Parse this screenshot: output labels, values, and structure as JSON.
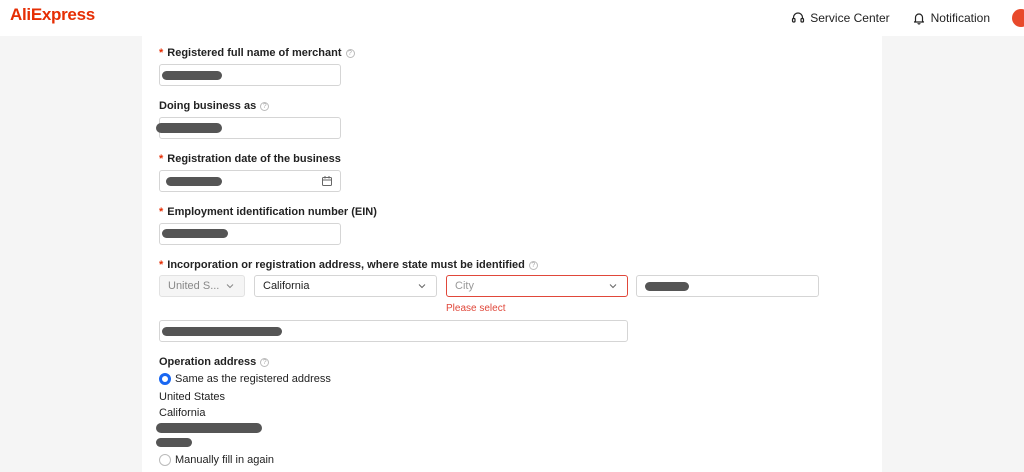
{
  "header": {
    "logo": "AliExpress",
    "service_center": "Service Center",
    "notification": "Notification"
  },
  "form": {
    "merchant_name_label": "Registered full name of merchant",
    "dba_label": "Doing business as",
    "reg_date_label": "Registration date of the business",
    "ein_label": "Employment identification number (EIN)",
    "address_label": "Incorporation or registration address, where state must be identified",
    "country_value": "United S...",
    "state_value": "California",
    "city_placeholder": "City",
    "city_error": "Please select",
    "operation_label": "Operation address",
    "same_address_option": "Same as the registered address",
    "op_country": "United States",
    "op_state": "California",
    "manual_option": "Manually fill in again",
    "required_mark": "*",
    "help_glyph": "?"
  },
  "colors": {
    "brand": "#e62e04",
    "error": "#e0473a",
    "radio_selected": "#1967f2"
  }
}
